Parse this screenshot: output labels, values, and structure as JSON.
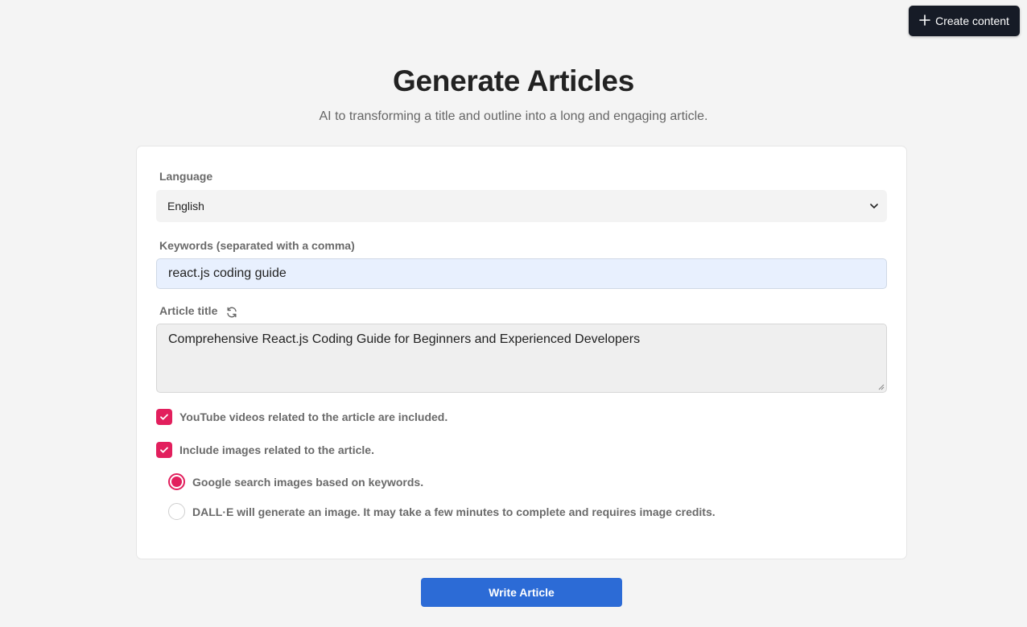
{
  "header": {
    "create_label": "Create content",
    "create_icon": "plus-icon"
  },
  "page": {
    "title": "Generate Articles",
    "subtitle": "AI to transforming a title and outline into a long and engaging article."
  },
  "form": {
    "language": {
      "label": "Language",
      "value": "English",
      "icon": "chevron-down-icon"
    },
    "keywords": {
      "label": "Keywords (separated with a comma)",
      "value": "react.js coding guide"
    },
    "article_title": {
      "label": "Article title",
      "icon": "refresh-icon",
      "value": "Comprehensive React.js Coding Guide for Beginners and Experienced Developers"
    },
    "options": [
      {
        "label": "YouTube videos related to the article are included.",
        "checked": true
      },
      {
        "label": "Include images related to the article.",
        "checked": true
      }
    ],
    "image_source": [
      {
        "label": "Google search images based on keywords.",
        "selected": true
      },
      {
        "label": "DALL·E will generate an image. It may take a few minutes to complete and requires image credits.",
        "selected": false
      }
    ]
  },
  "actions": {
    "write_label": "Write Article"
  },
  "colors": {
    "accent": "#e21f5d",
    "primary_button": "#2c6bd6",
    "dark_button": "#161b26"
  }
}
